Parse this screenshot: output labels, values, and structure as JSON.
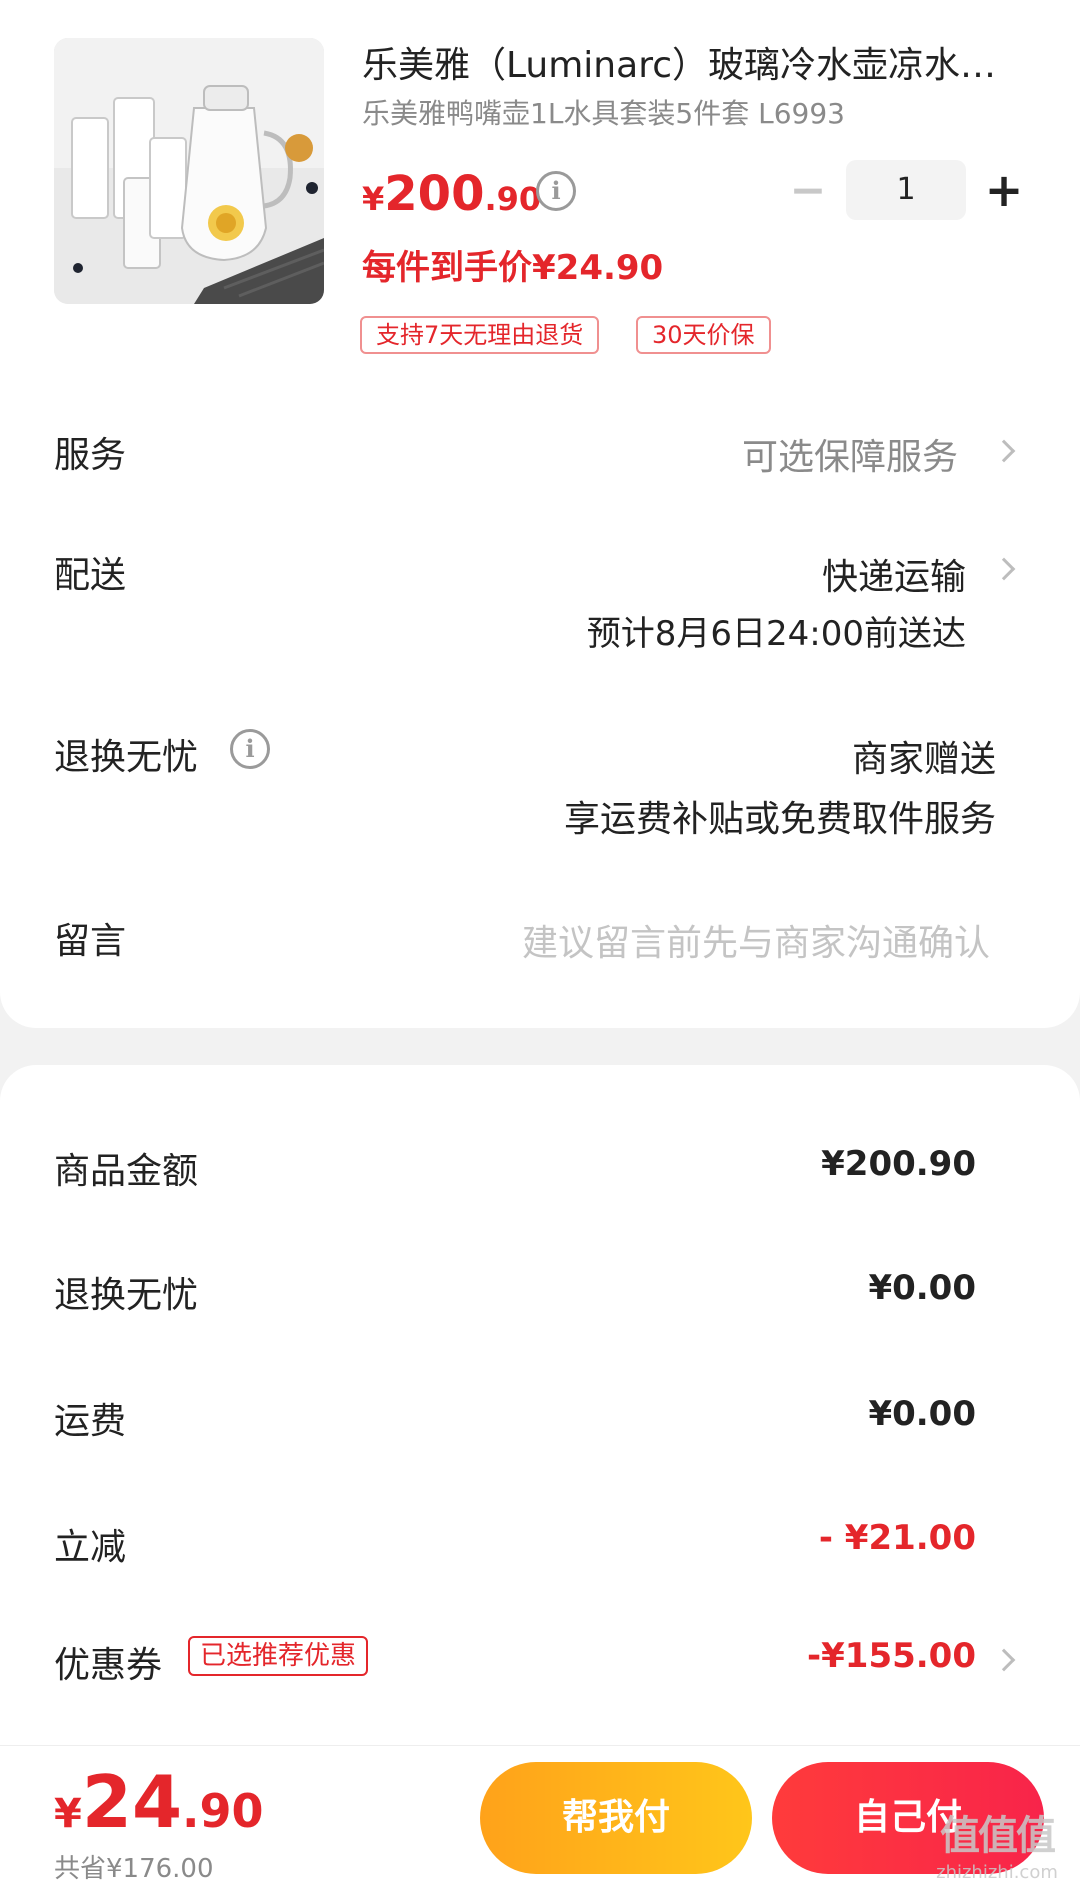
{
  "product": {
    "title": "乐美雅（Luminarc）玻璃冷水壶凉水壶玻璃杯套装",
    "sku": "乐美雅鸭嘴壶1L水具套装5件套 L6993",
    "price_currency": "¥",
    "price_int": "200",
    "price_dec": ".90",
    "unit_price": "每件到手价¥24.90",
    "quantity": "1",
    "qty_minus": "−",
    "qty_plus": "+",
    "tags": [
      "支持7天无理由退货",
      "30天价保"
    ]
  },
  "service": {
    "label": "服务",
    "value": "可选保障服务"
  },
  "delivery": {
    "label": "配送",
    "method": "快递运输",
    "eta": "预计8月6日24:00前送达"
  },
  "returns": {
    "label": "退换无忧",
    "value": "商家赠送",
    "desc": "享运费补贴或免费取件服务"
  },
  "message": {
    "label": "留言",
    "placeholder": "建议留言前先与商家沟通确认"
  },
  "summary": {
    "goods_label": "商品金额",
    "goods_value": "¥200.90",
    "returns_label": "退换无忧",
    "returns_value": "¥0.00",
    "shipping_label": "运费",
    "shipping_value": "¥0.00",
    "discount_label": "立减",
    "discount_value": "- ¥21.00",
    "coupon_label": "优惠券",
    "coupon_badge": "已选推荐优惠",
    "coupon_value": "-¥155.00"
  },
  "footer": {
    "total_currency": "¥",
    "total_int": "24",
    "total_dec": ".90",
    "saved": "共省¥176.00",
    "help_pay_label": "帮我付",
    "self_pay_label": "自己付"
  },
  "watermark": {
    "logo": "值值值",
    "site": "zhizhizhi.com"
  },
  "colors": {
    "accent": "#e4262b",
    "help_btn": "#ffb31a",
    "self_btn": "#f8304a"
  }
}
